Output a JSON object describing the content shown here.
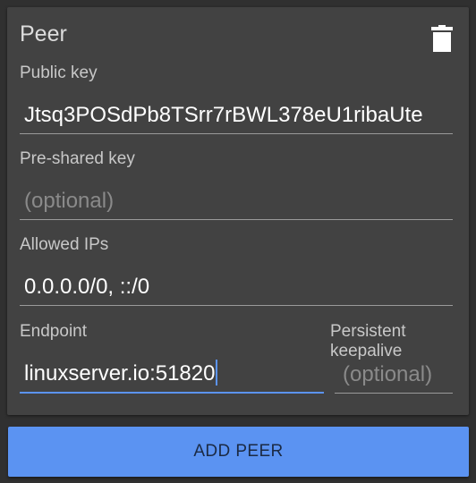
{
  "peer": {
    "title": "Peer",
    "delete_icon": "trash-icon",
    "public_key": {
      "label": "Public key",
      "value": "Jtsq3POSdPb8TSrr7rBWL378eU1ribaUte"
    },
    "preshared_key": {
      "label": "Pre-shared key",
      "placeholder": "(optional)",
      "value": ""
    },
    "allowed_ips": {
      "label": "Allowed IPs",
      "value": "0.0.0.0/0, ::/0"
    },
    "endpoint": {
      "label": "Endpoint",
      "value": "linuxserver.io:51820"
    },
    "keepalive": {
      "label_line1": "Persistent",
      "label_line2": "keepalive",
      "placeholder": "(optional)",
      "value": ""
    }
  },
  "actions": {
    "add_peer_label": "ADD PEER"
  },
  "colors": {
    "background": "#303030",
    "card": "#424242",
    "accent": "#5b93f2"
  }
}
